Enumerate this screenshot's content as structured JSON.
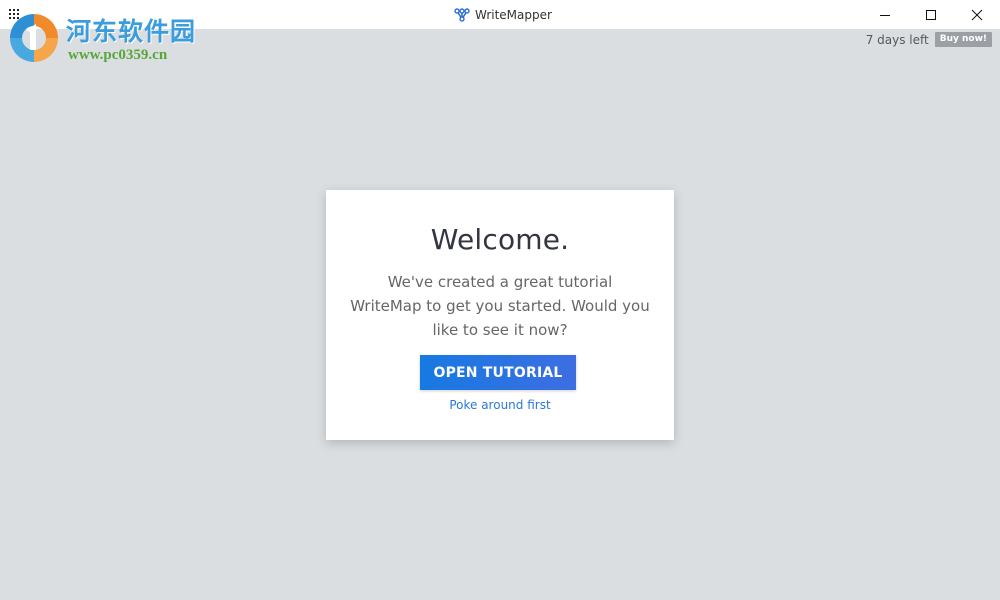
{
  "window": {
    "title": "WriteMapper",
    "controls": {
      "minimize": "minimize-icon",
      "maximize": "maximize-icon",
      "close": "close-icon"
    }
  },
  "watermark": {
    "title": "河东软件园",
    "url": "www.pc0359.cn"
  },
  "trial": {
    "days_left": "7 days left",
    "buy_label": "Buy now!"
  },
  "dialog": {
    "heading": "Welcome.",
    "message": "We've created a great tutorial WriteMap to get you started. Would you like to see it now?",
    "primary_button": "OPEN TUTORIAL",
    "secondary_link": "Poke around first"
  },
  "colors": {
    "background": "#dadee1",
    "accent": "#1779e3",
    "buy_badge": "#9ca0a4"
  }
}
